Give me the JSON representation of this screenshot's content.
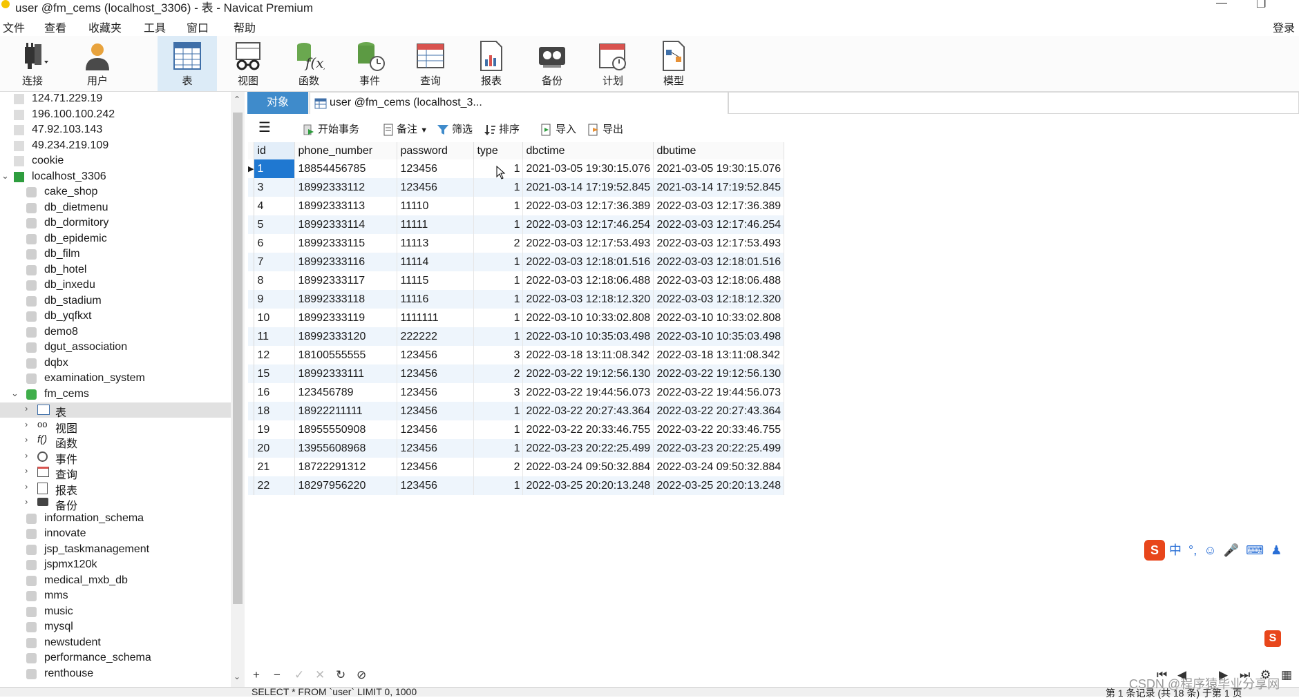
{
  "window": {
    "title": "user @fm_cems (localhost_3306) - 表 - Navicat Premium"
  },
  "menu": [
    "文件",
    "查看",
    "收藏夹",
    "工具",
    "窗口",
    "帮助"
  ],
  "login_label": "登录",
  "toolbar": [
    "连接",
    "用户",
    "表",
    "视图",
    "函数",
    "事件",
    "查询",
    "报表",
    "备份",
    "计划",
    "模型"
  ],
  "tree": {
    "connections_top": [
      "124.71.229.19",
      "196.100.100.242",
      "47.92.103.143",
      "49.234.219.109",
      "cookie"
    ],
    "localhost": "localhost_3306",
    "dbs_before": [
      "cake_shop",
      "db_dietmenu",
      "db_dormitory",
      "db_epidemic",
      "db_film",
      "db_hotel",
      "db_inxedu",
      "db_stadium",
      "db_yqfkxt",
      "demo8",
      "dgut_association",
      "dqbx",
      "examination_system"
    ],
    "current_db": "fm_cems",
    "current_children": [
      "表",
      "视图",
      "函数",
      "事件",
      "查询",
      "报表",
      "备份"
    ],
    "dbs_after": [
      "information_schema",
      "innovate",
      "jsp_taskmanagement",
      "jspmx120k",
      "medical_mxb_db",
      "mms",
      "music",
      "mysql",
      "newstudent",
      "performance_schema",
      "renthouse"
    ]
  },
  "tabs": {
    "objects": "对象",
    "table_tab": "user @fm_cems (localhost_3..."
  },
  "grid_toolbar": {
    "begin_tx": "开始事务",
    "note": "备注",
    "filter": "筛选",
    "sort": "排序",
    "import": "导入",
    "export": "导出"
  },
  "columns": [
    "id",
    "phone_number",
    "password",
    "type",
    "dbctime",
    "dbutime"
  ],
  "rows": [
    [
      "1",
      "18854456785",
      "123456",
      "1",
      "2021-03-05 19:30:15.076",
      "2021-03-05 19:30:15.076"
    ],
    [
      "3",
      "18992333112",
      "123456",
      "1",
      "2021-03-14 17:19:52.845",
      "2021-03-14 17:19:52.845"
    ],
    [
      "4",
      "18992333113",
      "11110",
      "1",
      "2022-03-03 12:17:36.389",
      "2022-03-03 12:17:36.389"
    ],
    [
      "5",
      "18992333114",
      "11111",
      "1",
      "2022-03-03 12:17:46.254",
      "2022-03-03 12:17:46.254"
    ],
    [
      "6",
      "18992333115",
      "11113",
      "2",
      "2022-03-03 12:17:53.493",
      "2022-03-03 12:17:53.493"
    ],
    [
      "7",
      "18992333116",
      "11114",
      "1",
      "2022-03-03 12:18:01.516",
      "2022-03-03 12:18:01.516"
    ],
    [
      "8",
      "18992333117",
      "11115",
      "1",
      "2022-03-03 12:18:06.488",
      "2022-03-03 12:18:06.488"
    ],
    [
      "9",
      "18992333118",
      "11116",
      "1",
      "2022-03-03 12:18:12.320",
      "2022-03-03 12:18:12.320"
    ],
    [
      "10",
      "18992333119",
      "1111111",
      "1",
      "2022-03-10 10:33:02.808",
      "2022-03-10 10:33:02.808"
    ],
    [
      "11",
      "18992333120",
      "222222",
      "1",
      "2022-03-10 10:35:03.498",
      "2022-03-10 10:35:03.498"
    ],
    [
      "12",
      "18100555555",
      "123456",
      "3",
      "2022-03-18 13:11:08.342",
      "2022-03-18 13:11:08.342"
    ],
    [
      "15",
      "18992333111",
      "123456",
      "2",
      "2022-03-22 19:12:56.130",
      "2022-03-22 19:12:56.130"
    ],
    [
      "16",
      "123456789",
      "123456",
      "3",
      "2022-03-22 19:44:56.073",
      "2022-03-22 19:44:56.073"
    ],
    [
      "18",
      "18922211111",
      "123456",
      "1",
      "2022-03-22 20:27:43.364",
      "2022-03-22 20:27:43.364"
    ],
    [
      "19",
      "18955550908",
      "123456",
      "1",
      "2022-03-22 20:33:46.755",
      "2022-03-22 20:33:46.755"
    ],
    [
      "20",
      "13955608968",
      "123456",
      "1",
      "2022-03-23 20:22:25.499",
      "2022-03-23 20:22:25.499"
    ],
    [
      "21",
      "18722291312",
      "123456",
      "2",
      "2022-03-24 09:50:32.884",
      "2022-03-24 09:50:32.884"
    ],
    [
      "22",
      "18297956220",
      "123456",
      "1",
      "2022-03-25 20:20:13.248",
      "2022-03-25 20:20:13.248"
    ]
  ],
  "status": {
    "sql": "SELECT * FROM `user` LIMIT 0, 1000",
    "records": "第 1 条记录 (共 18 条) 于第 1 页"
  },
  "ime": {
    "lang": "中"
  },
  "watermark": "CSDN @程序猿毕业分享网",
  "colors": {
    "accent": "#3f8bcb",
    "selected_cell": "#1f78d1",
    "stripe": "#eef5fc"
  }
}
